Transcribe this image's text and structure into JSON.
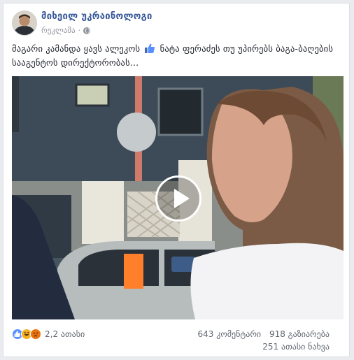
{
  "page": {
    "name": "მიხეილ უკრაინოლოგი",
    "meta_label": "რეკლამა",
    "meta_separator": "·"
  },
  "post": {
    "text_before_emoji": "მაგარი კამანდა ყავს ალეკოს",
    "text_after_emoji": "ნატა ფერაძეს თუ უპირებს ბაგა-ბაღების სააგენტოს დირექტორობას..."
  },
  "icons": {
    "inline_emoji": "thumbs-up-icon",
    "play": "play-icon",
    "privacy": "globe-icon"
  },
  "stats": {
    "reactions_count": "2,2 ათასი",
    "comments": "643 კომენტარი",
    "shares": "918 გაზიარება",
    "views": "251 ათასი ნახვა"
  },
  "colors": {
    "link": "#365899",
    "like_reaction": "#5890ff",
    "haha_reaction": "#f7b125",
    "angry_reaction": "#e9710f"
  }
}
